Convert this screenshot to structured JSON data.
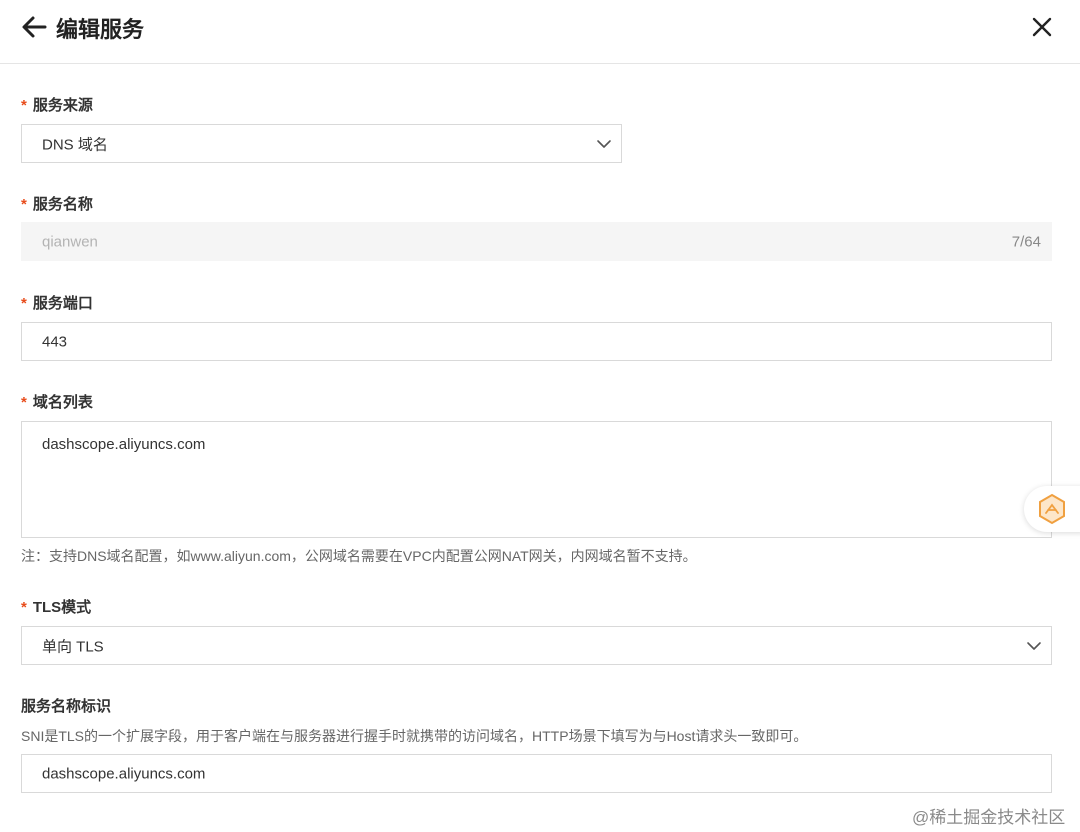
{
  "header": {
    "title": "编辑服务"
  },
  "form": {
    "source": {
      "required_mark": "*",
      "label": "服务来源",
      "value": "DNS 域名"
    },
    "name": {
      "required_mark": "*",
      "label": "服务名称",
      "value": "qianwen",
      "counter": "7/64"
    },
    "port": {
      "required_mark": "*",
      "label": "服务端口",
      "value": "443"
    },
    "domains": {
      "required_mark": "*",
      "label": "域名列表",
      "value": "dashscope.aliyuncs.com",
      "note": "注：支持DNS域名配置，如www.aliyun.com，公网域名需要在VPC内配置公网NAT网关，内网域名暂不支持。"
    },
    "tls": {
      "required_mark": "*",
      "label": "TLS模式",
      "value": "单向 TLS"
    },
    "sni": {
      "label": "服务名称标识",
      "description": "SNI是TLS的一个扩展字段，用于客户端在与服务器进行握手时就携带的访问域名，HTTP场景下填写为与Host请求头一致即可。",
      "value": "dashscope.aliyuncs.com"
    }
  },
  "watermark": "@稀土掘金技术社区",
  "icons": {
    "back": "arrow-left-icon",
    "close": "close-icon",
    "select": "chevron-down-icon",
    "widget": "assistant-icon"
  },
  "colors": {
    "required": "#e84c1b",
    "border": "#d9d9d9",
    "disabled_bg": "#f5f5f5",
    "widget_accent": "#f0a040"
  }
}
